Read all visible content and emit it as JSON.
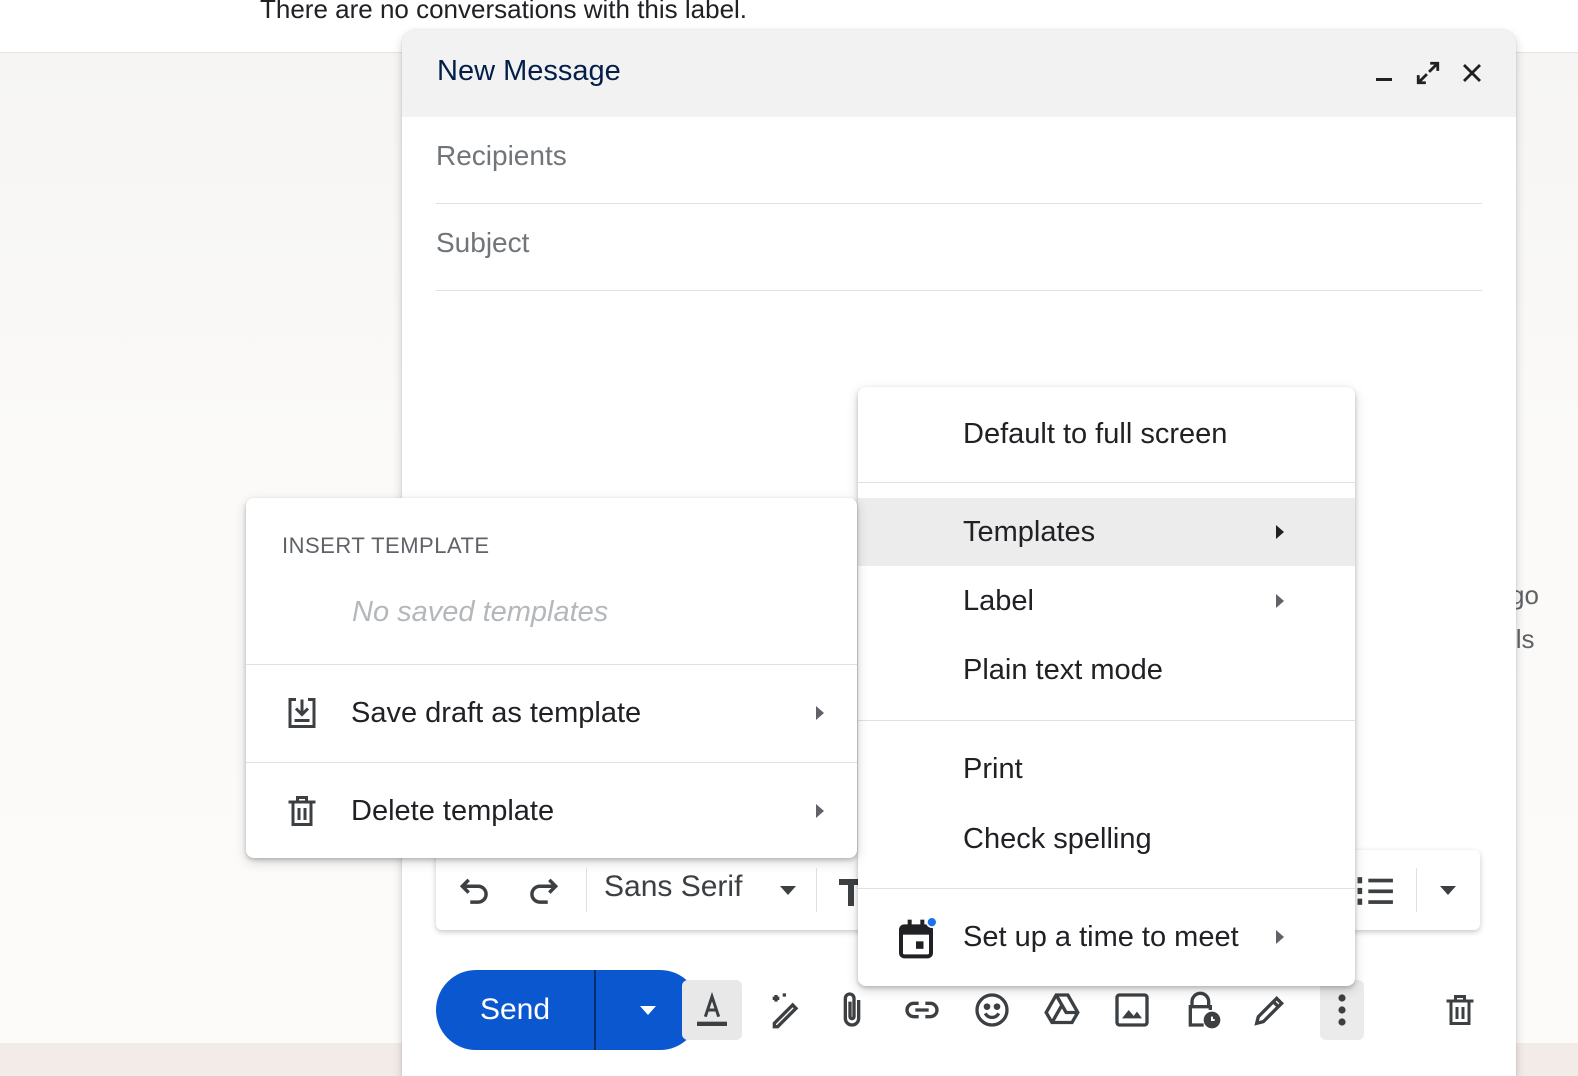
{
  "background": {
    "top_text": "There are no conversations with this label.",
    "side_text_1": "go",
    "side_text_2": "ils"
  },
  "compose": {
    "title": "New Message",
    "header_buttons": [
      {
        "name": "minimize",
        "icon": "minimize-icon"
      },
      {
        "name": "expand",
        "icon": "expand-icon"
      },
      {
        "name": "close",
        "icon": "close-icon"
      }
    ],
    "recipients_placeholder": "Recipients",
    "subject_placeholder": "Subject",
    "font_family": "Sans Serif",
    "send_label": "Send",
    "bottom_icons": [
      "text-format-icon",
      "ai-write-icon",
      "attach-icon",
      "link-icon",
      "emoji-icon",
      "drive-icon",
      "photo-icon",
      "confidential-icon",
      "signature-icon",
      "more-options-icon",
      "trash-icon"
    ]
  },
  "more_menu": {
    "items": [
      {
        "label": "Default to full screen"
      },
      {
        "label": "Templates",
        "submenu": true,
        "highlighted": true
      },
      {
        "label": "Label",
        "submenu": true
      },
      {
        "label": "Plain text mode"
      },
      {
        "label": "Print"
      },
      {
        "label": "Check spelling"
      },
      {
        "label": "Set up a time to meet",
        "submenu": true,
        "icon": "calendar-icon"
      }
    ]
  },
  "templates_menu": {
    "heading": "INSERT TEMPLATE",
    "empty_text": "No saved templates",
    "items": [
      {
        "label": "Save draft as template",
        "icon": "save-template-icon"
      },
      {
        "label": "Delete template",
        "icon": "trash-icon"
      }
    ]
  },
  "colors": {
    "send": "#0b57d0",
    "title": "#041e49",
    "calendar_dot": "#1a73e8"
  }
}
